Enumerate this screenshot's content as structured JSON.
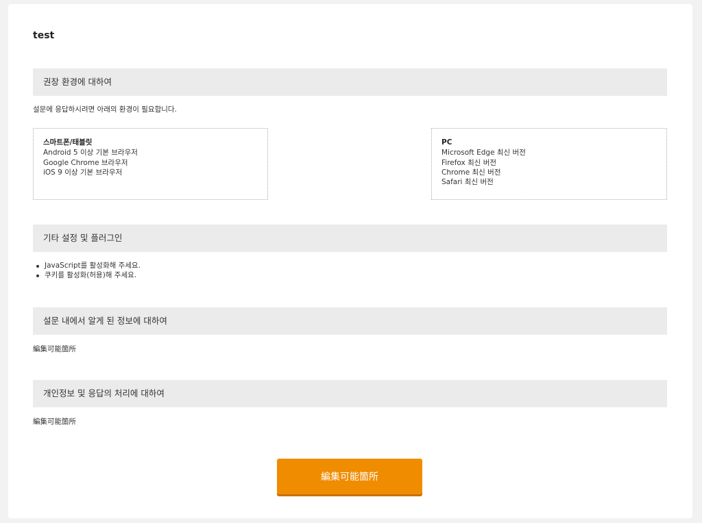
{
  "survey": {
    "title": "test"
  },
  "sections": {
    "env": {
      "heading": "권장 환경에 대하여",
      "intro": "설문에 응답하시려면 아래의 환경이 필요합니다.",
      "mobile": {
        "title": "스마트폰/태블릿",
        "items": [
          "Android 5 이상 기본 브라우저",
          "Google Chrome 브라우저",
          "iOS 9 이상 기본 브라우저"
        ]
      },
      "pc": {
        "title": "PC",
        "items": [
          "Microsoft Edge 최신 버전",
          "Firefox 최신 버전",
          "Chrome 최신 버전",
          "Safari 최신 버전"
        ]
      }
    },
    "settings": {
      "heading": "기타 설정 및 플러그인",
      "items": [
        "JavaScript를 활성화해 주세요.",
        "쿠키를 활성화(허용)해 주세요."
      ]
    },
    "info": {
      "heading": "설문 내에서 알게 된 정보에 대하여",
      "body": "編集可能箇所"
    },
    "privacy": {
      "heading": "개인정보 및 응답의 처리에 대하여",
      "body": "編集可能箇所"
    }
  },
  "submit": {
    "label": "編集可能箇所"
  },
  "colors": {
    "accent": "#f08c00",
    "header_bg": "#ebebeb",
    "page_bg": "#f2f2f2"
  }
}
